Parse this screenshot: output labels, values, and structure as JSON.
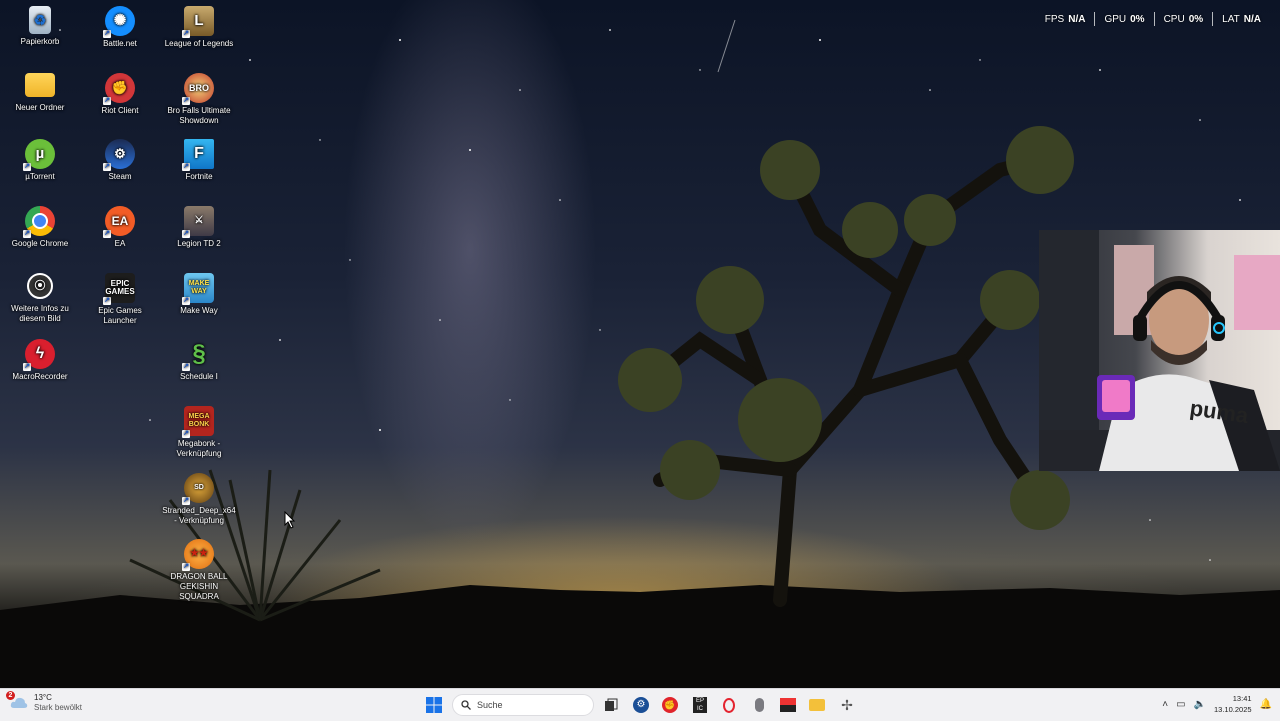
{
  "desktop": {
    "icons": [
      {
        "label": "Papierkorb"
      },
      {
        "label": "Battle.net"
      },
      {
        "label": "League of Legends"
      },
      {
        "label": "Neuer Ordner"
      },
      {
        "label": "Riot Client"
      },
      {
        "label": "Bro Falls Ultimate Showdown"
      },
      {
        "label": "µTorrent"
      },
      {
        "label": "Steam"
      },
      {
        "label": "Fortnite"
      },
      {
        "label": "Google Chrome"
      },
      {
        "label": "EA"
      },
      {
        "label": "Legion TD 2"
      },
      {
        "label": "Weitere Infos zu diesem Bild"
      },
      {
        "label": "Epic Games Launcher"
      },
      {
        "label": "Make Way"
      },
      {
        "label": "MacroRecorder"
      },
      {
        "label": "Schedule I"
      },
      {
        "label": "Megabonk - Verknüpfung"
      },
      {
        "label": "Stranded_Deep_x64 - Verknüpfung"
      },
      {
        "label": "DRAGON BALL GEKISHIN SQUADRA"
      }
    ]
  },
  "hud": {
    "fps_label": "FPS",
    "fps_value": "N/A",
    "gpu_label": "GPU",
    "gpu_value": "0%",
    "cpu_label": "CPU",
    "cpu_value": "0%",
    "lat_label": "LAT",
    "lat_value": "N/A"
  },
  "taskbar": {
    "weather_temp": "13°C",
    "weather_cond": "Stark bewölkt",
    "weather_badge": "2",
    "search_placeholder": "Suche",
    "time": "13:41",
    "date": "13.10.2025",
    "pinned_apps": [
      "start",
      "task-view",
      "steam",
      "riot-client",
      "epic-games",
      "opera-gx",
      "mouse-software",
      "stream-app",
      "file-explorer",
      "settings-fan"
    ]
  },
  "colors": {
    "taskbar_bg": "#f1f1f3",
    "start_blue": "#1a73e8",
    "hud_text": "#ffffff"
  }
}
